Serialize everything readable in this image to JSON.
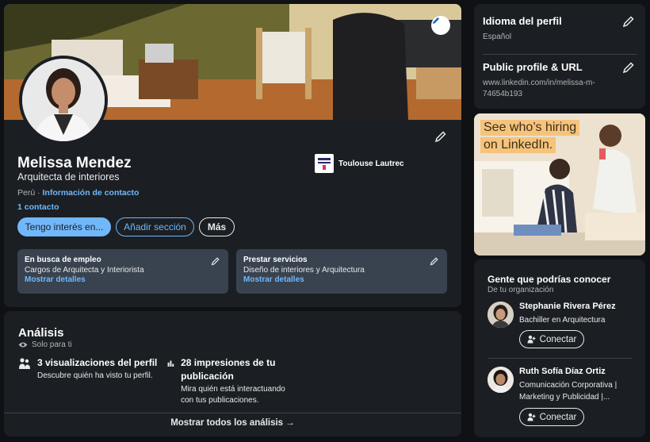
{
  "profile": {
    "name": "Melissa Mendez",
    "headline": "Arquitecta de interiores",
    "location": "Perú ·",
    "contact_info_link": "Información de contacto",
    "connections": "1 contacto",
    "organization": {
      "name": "Toulouse Lautrec",
      "logo_icon": "toulouse-lautrec-logo"
    },
    "actions": {
      "open_to": "Tengo interés en...",
      "add_section": "Añadir sección",
      "more": "Más"
    },
    "open_to_work": {
      "title": "En busca de empleo",
      "detail": "Cargos de Arquitecta y Interiorista",
      "link": "Mostrar detalles"
    },
    "services": {
      "title": "Prestar servicios",
      "detail": "Diseño de interiores y Arquitectura",
      "link": "Mostrar detalles"
    }
  },
  "analytics": {
    "title": "Análisis",
    "visibility": "Solo para ti",
    "profile_views": {
      "title": "3 visualizaciones del perfil",
      "desc": "Descubre quién ha visto tu perfil."
    },
    "impressions": {
      "title": "28 impresiones de tu publicación",
      "desc": "Mira quién está interactuando con tus publicaciones."
    },
    "footer_link": "Mostrar todos los análisis →"
  },
  "settings": {
    "language": {
      "title": "Idioma del perfil",
      "value": "Español"
    },
    "public_url": {
      "title": "Public profile & URL",
      "value": "www.linkedin.com/in/melissa-m-74654b193"
    }
  },
  "ad": {
    "line1": "See who’s hiring",
    "line2": "on LinkedIn."
  },
  "people": {
    "title": "Gente que podrías conocer",
    "subtitle": "De tu organización",
    "items": [
      {
        "name": "Stephanie Rivera Pérez",
        "headline": "Bachiller en Arquitectura",
        "button": "Conectar"
      },
      {
        "name": "Ruth Sofía Díaz Ortiz",
        "headline": "Comunicación Corporativa | Marketing y Publicidad |...",
        "button": "Conectar"
      }
    ]
  },
  "colors": {
    "accent": "#71b7fb",
    "card": "#1b1f23",
    "page": "#0f1114",
    "box": "#38434f"
  }
}
